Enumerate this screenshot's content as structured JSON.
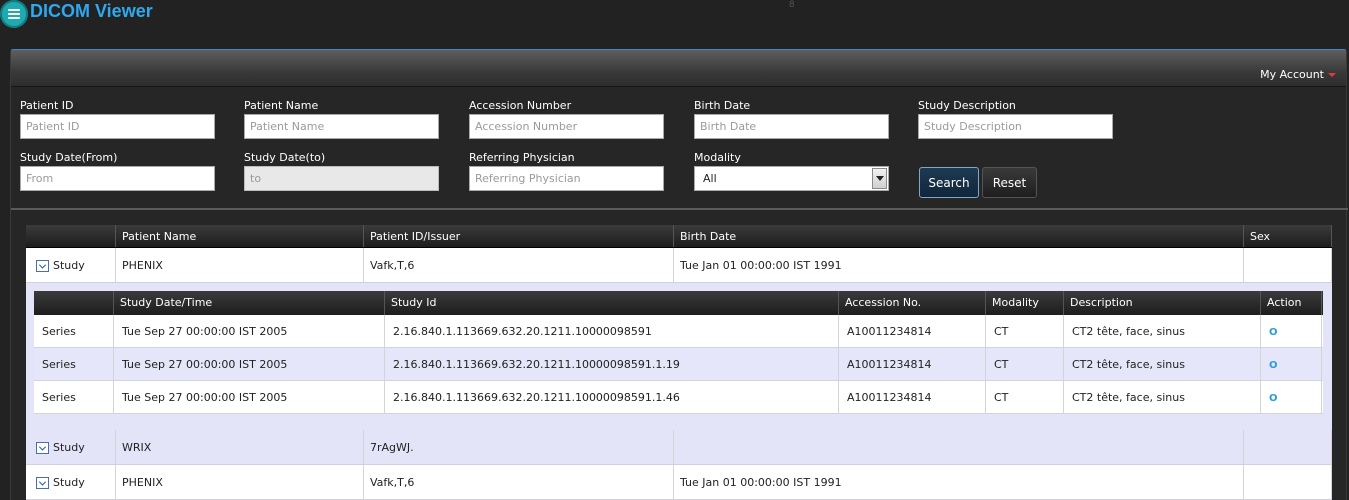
{
  "app": {
    "title": "DICOM Viewer",
    "mark": "8"
  },
  "header": {
    "account_label": "My Account"
  },
  "search": {
    "fields": [
      {
        "label": "Patient ID",
        "placeholder": "Patient ID"
      },
      {
        "label": "Patient Name",
        "placeholder": "Patient Name"
      },
      {
        "label": "Accession Number",
        "placeholder": "Accession Number"
      },
      {
        "label": "Birth Date",
        "placeholder": "Birth Date"
      },
      {
        "label": "Study Description",
        "placeholder": "Study Description"
      },
      {
        "label": "Study Date(From)",
        "placeholder": "From"
      },
      {
        "label": "Study Date(to)",
        "placeholder": "to"
      },
      {
        "label": "Referring Physician",
        "placeholder": "Referring Physician"
      }
    ],
    "modality": {
      "label": "Modality",
      "value": "All"
    },
    "search_label": "Search",
    "reset_label": "Reset"
  },
  "grid": {
    "columns": [
      "",
      "Patient Name",
      "Patient ID/Issuer",
      "Birth Date",
      "Sex"
    ],
    "rows": [
      {
        "type": "Study",
        "name": "PHENIX",
        "id": "Vafk,T,6",
        "birth": "Tue Jan 01 00:00:00 IST 1991",
        "sex": ""
      },
      {
        "type": "Study",
        "name": "WRIX",
        "id": "7rAgWJ.",
        "birth": "",
        "sex": ""
      },
      {
        "type": "Study",
        "name": "PHENIX",
        "id": "Vafk,T,6",
        "birth": "Tue Jan 01 00:00:00 IST 1991",
        "sex": ""
      }
    ],
    "series_columns": [
      "",
      "Study Date/Time",
      "Study Id",
      "Accession No.",
      "Modality",
      "Description",
      "Action"
    ],
    "series_rows": [
      {
        "type": "Series",
        "date": "Tue Sep 27 00:00:00 IST 2005",
        "study_id": "2.16.840.1.113669.632.20.1211.10000098591",
        "accession": "A10011234814",
        "modality": "CT",
        "description": "CT2 tête, face, sinus",
        "action": "O"
      },
      {
        "type": "Series",
        "date": "Tue Sep 27 00:00:00 IST 2005",
        "study_id": "2.16.840.1.113669.632.20.1211.10000098591.1.19",
        "accession": "A10011234814",
        "modality": "CT",
        "description": "CT2 tête, face, sinus",
        "action": "O"
      },
      {
        "type": "Series",
        "date": "Tue Sep 27 00:00:00 IST 2005",
        "study_id": "2.16.840.1.113669.632.20.1211.10000098591.1.46",
        "accession": "A10011234814",
        "modality": "CT",
        "description": "CT2 tête, face, sinus",
        "action": "O"
      }
    ]
  },
  "colors": {
    "accent": "#2fa8ee",
    "logo": "#1fa9b0",
    "panel": "#262626",
    "row_alt": "#e4e4f8"
  }
}
